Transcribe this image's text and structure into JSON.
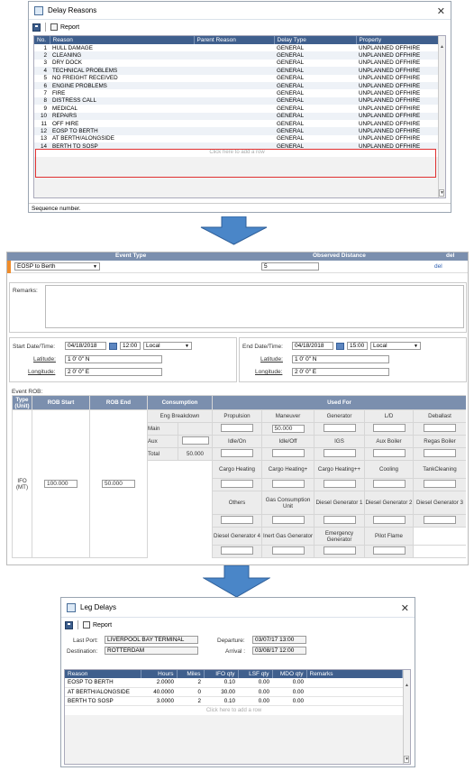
{
  "delay_reasons": {
    "title": "Delay Reasons",
    "report_label": "Report",
    "columns": [
      "No.",
      "Reason",
      "Parent Reason",
      "Delay Type",
      "Property"
    ],
    "rows": [
      {
        "no": "1",
        "reason": "HULL DAMAGE",
        "parent": "",
        "type": "GENERAL",
        "property": "UNPLANNED OFFHIRE"
      },
      {
        "no": "2",
        "reason": "CLEANING",
        "parent": "",
        "type": "GENERAL",
        "property": "UNPLANNED OFFHIRE"
      },
      {
        "no": "3",
        "reason": "DRY DOCK",
        "parent": "",
        "type": "GENERAL",
        "property": "UNPLANNED OFFHIRE"
      },
      {
        "no": "4",
        "reason": "TECHNICAL PROBLEMS",
        "parent": "",
        "type": "GENERAL",
        "property": "UNPLANNED OFFHIRE"
      },
      {
        "no": "5",
        "reason": "NO FREIGHT RECEIVED",
        "parent": "",
        "type": "GENERAL",
        "property": "UNPLANNED OFFHIRE"
      },
      {
        "no": "6",
        "reason": "ENGINE PROBLEMS",
        "parent": "",
        "type": "GENERAL",
        "property": "UNPLANNED OFFHIRE"
      },
      {
        "no": "7",
        "reason": "FIRE",
        "parent": "",
        "type": "GENERAL",
        "property": "UNPLANNED OFFHIRE"
      },
      {
        "no": "8",
        "reason": "DISTRESS CALL",
        "parent": "",
        "type": "GENERAL",
        "property": "UNPLANNED OFFHIRE"
      },
      {
        "no": "9",
        "reason": "MEDICAL",
        "parent": "",
        "type": "GENERAL",
        "property": "UNPLANNED OFFHIRE"
      },
      {
        "no": "10",
        "reason": "REPAIRS",
        "parent": "",
        "type": "GENERAL",
        "property": "UNPLANNED OFFHIRE"
      },
      {
        "no": "11",
        "reason": "OFF HIRE",
        "parent": "",
        "type": "GENERAL",
        "property": "UNPLANNED OFFHIRE"
      },
      {
        "no": "12",
        "reason": "EOSP TO BERTH",
        "parent": "",
        "type": "GENERAL",
        "property": "UNPLANNED OFFHIRE"
      },
      {
        "no": "13",
        "reason": "AT BERTH/ALONGSIDE",
        "parent": "",
        "type": "GENERAL",
        "property": "UNPLANNED OFFHIRE"
      },
      {
        "no": "14",
        "reason": "BERTH TO SOSP",
        "parent": "",
        "type": "GENERAL",
        "property": "UNPLANNED OFFHIRE"
      }
    ],
    "add_row": "Click here to add a row",
    "status": "Sequence number.",
    "highlight_color": "#e03030"
  },
  "event": {
    "col_event_type": "Event Type",
    "col_observed_distance": "Observed Distance",
    "col_del": "del",
    "event_type_value": "EOSP to Berth",
    "observed_distance_value": "5",
    "del_link": "del",
    "remarks_label": "Remarks:",
    "start": {
      "label": "Start Date/Time:",
      "date": "04/18/2018",
      "time": "12:00",
      "tz": "Local",
      "lat_label": "Latitude:",
      "lat": "1 0' 0\" N",
      "lon_label": "Longitude:",
      "lon": "2 0' 0\" E"
    },
    "end": {
      "label": "End Date/Time:",
      "date": "04/18/2018",
      "time": "15:00",
      "tz": "Local",
      "lat_label": "Latitude:",
      "lat": "1 0' 0\" N",
      "lon_label": "Longitude:",
      "lon": "2 0' 0\" E"
    },
    "rob_label": "Event ROB:",
    "rob_headers": {
      "type_unit": "Type (Unit)",
      "rob_start": "ROB Start",
      "rob_end": "ROB End",
      "consumption": "Consumption",
      "used_for": "Used For"
    },
    "fuel_type": "IFO (MT)",
    "rob_start_value": "100.000",
    "rob_end_value": "50.000",
    "eng_breakdown": "Eng Breakdown",
    "main": "Main",
    "aux": "Aux",
    "total": "Total",
    "total_value": "50.000",
    "maneuver_value": "50.000",
    "used_for_rows": [
      [
        "Propulsion",
        "Maneuver",
        "Generator",
        "L/D",
        "Deballast"
      ],
      [
        "Idle/On",
        "Idle/Off",
        "IGS",
        "Aux Boiler",
        "Regas Boiler"
      ],
      [
        "Cargo Heating",
        "Cargo Heating+",
        "Cargo Heating++",
        "Cooling",
        "TankCleaning"
      ],
      [
        "Others",
        "Gas Consumption Unit",
        "Diesel Generator 1",
        "Diesel Generator 2",
        "Diesel Generator 3"
      ],
      [
        "Diesel Generator 4",
        "Inert Gas Generator",
        "Emergency Generator",
        "Pilot Flame",
        ""
      ]
    ]
  },
  "leg_delays": {
    "title": "Leg Delays",
    "report_label": "Report",
    "last_port_label": "Last Port:",
    "last_port": "LIVERPOOL BAY TERMINAL",
    "destination_label": "Destination:",
    "destination": "ROTTERDAM",
    "departure_label": "Departure:",
    "departure": "03/07/17  13:00",
    "arrival_label": "Arrival :",
    "arrival": "03/08/17  12:00",
    "columns": [
      "Reason",
      "Hours",
      "Miles",
      "IFO qty",
      "LSF qty",
      "MDO qty",
      "Remarks"
    ],
    "rows": [
      {
        "reason": "EOSP TO BERTH",
        "hours": "2.0000",
        "miles": "2",
        "ifo": "0.10",
        "lsf": "0.00",
        "mdo": "0.00",
        "remarks": ""
      },
      {
        "reason": "AT BERTH/ALONGSIDE",
        "hours": "40.0000",
        "miles": "0",
        "ifo": "30.00",
        "lsf": "0.00",
        "mdo": "0.00",
        "remarks": ""
      },
      {
        "reason": "BERTH TO SOSP",
        "hours": "3.0000",
        "miles": "2",
        "ifo": "0.10",
        "lsf": "0.00",
        "mdo": "0.00",
        "remarks": ""
      }
    ],
    "add_row": "Click here to add a row"
  },
  "arrow_color": "#4a86c8"
}
